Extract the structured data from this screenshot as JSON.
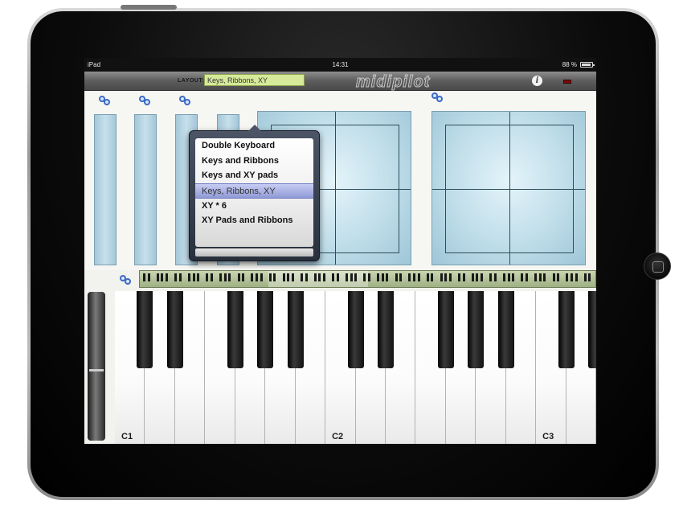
{
  "status_bar": {
    "carrier": "iPad",
    "time": "14:31",
    "battery": "88 %"
  },
  "toolbar": {
    "layout_label": "LAYOUT:",
    "layout_value": "Keys, Ribbons, XY",
    "logo": "midipilot",
    "info_icon": "info-icon",
    "record_icon": "record-indicator"
  },
  "layout_menu": {
    "items": [
      "Double Keyboard",
      "Keys and Ribbons",
      "Keys and XY pads",
      "Keys, Ribbons, XY",
      "XY * 6",
      "XY Pads and Ribbons"
    ],
    "selected_index": 3
  },
  "icons": {
    "link": "link-settings-icon"
  },
  "keyboard": {
    "labels": [
      "C1",
      "C2",
      "C3"
    ],
    "white_key_count": 16,
    "octave_labels_on_keys": [
      0,
      7,
      14
    ]
  },
  "colors": {
    "accent_field": "#d6ea9a",
    "pad_blue": "#bfdde9",
    "selection": "#8f99d6"
  }
}
